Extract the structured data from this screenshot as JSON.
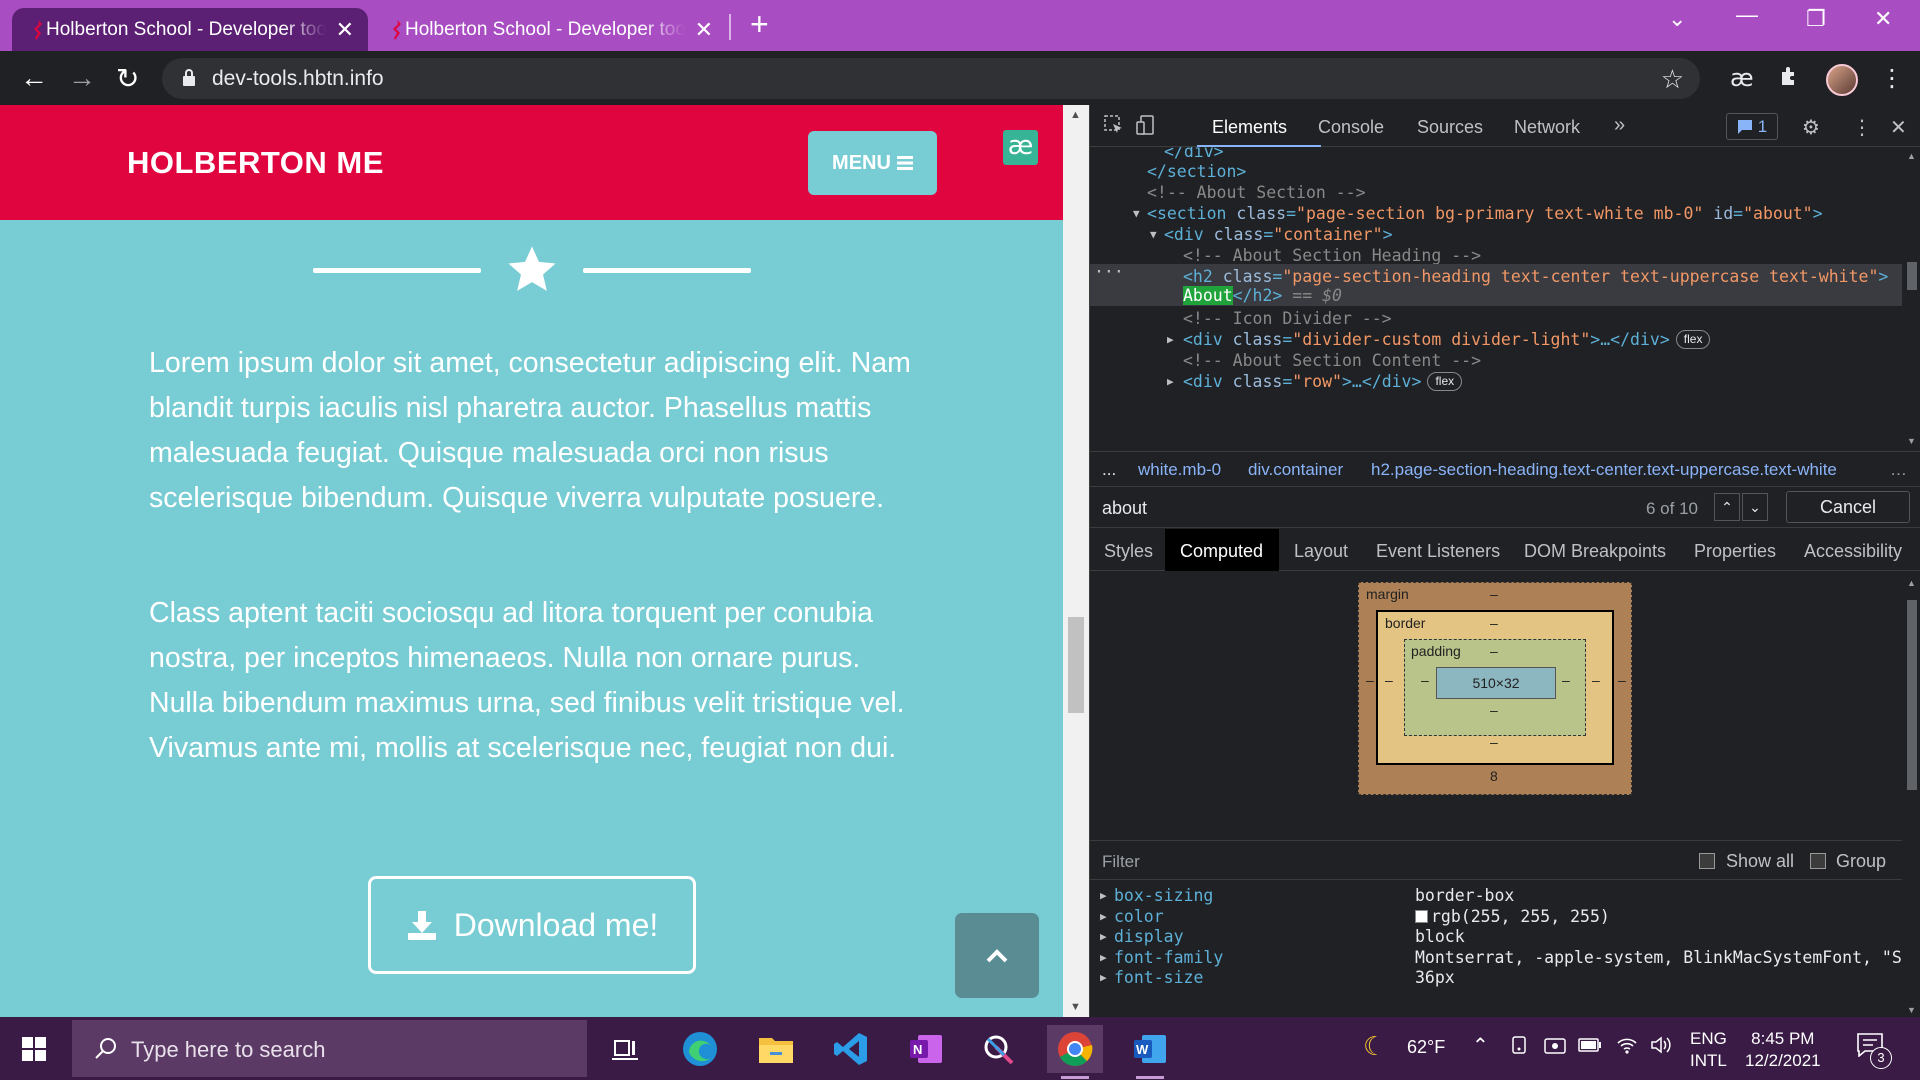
{
  "browser": {
    "tabs": [
      {
        "title": "Holberton School - Developer tools",
        "active": true
      },
      {
        "title": "Holberton School - Developer tools",
        "active": false
      }
    ],
    "url": "dev-tools.hbtn.info"
  },
  "page": {
    "brand": "HOLBERTON ME",
    "menu_label": "MENU",
    "paragraphs": [
      "Lorem ipsum dolor sit amet, consectetur adipiscing elit. Nam blandit turpis iaculis nisl pharetra auctor. Phasellus mattis malesuada feugiat. Quisque malesuada orci non risus scelerisque bibendum. Quisque viverra vulputate posuere.",
      "Class aptent taciti sociosqu ad litora torquent per conubia nostra, per inceptos himenaeos. Nulla non ornare purus. Nulla bibendum maximus urna, sed finibus velit tristique vel. Vivamus ante mi, mollis at scelerisque nec, feugiat non dui."
    ],
    "download_label": "Download me!",
    "colors": {
      "nav": "#e0053f",
      "bg": "#78ccd3"
    }
  },
  "devtools": {
    "tabs": [
      "Elements",
      "Console",
      "Sources",
      "Network"
    ],
    "issues_count": "1",
    "dom": {
      "line0_close": "</div>",
      "line1_close": "</section>",
      "comment_about_section": "<!-- About Section -->",
      "section_tag": "section",
      "section_class": "\"page-section bg-primary text-white mb-0\"",
      "section_id": "\"about\"",
      "div_container_class": "\"container\"",
      "comment_heading": "<!-- About Section Heading -->",
      "h2_class": "\"page-section-heading text-center text-uppercase text-white\"",
      "h2_text": "About",
      "h2_suffix": "== $0",
      "comment_divider": "<!-- Icon Divider -->",
      "div_divider_class": "\"divider-custom divider-light\"",
      "comment_content": "<!-- About Section Content -->",
      "div_row_class": "\"row\"",
      "pill_flex": "flex"
    },
    "breadcrumbs": [
      "...",
      "white.mb-0",
      "div.container",
      "h2.page-section-heading.text-center.text-uppercase.text-white"
    ],
    "search": {
      "query": "about",
      "match": "6 of 10",
      "cancel_label": "Cancel"
    },
    "subtabs": [
      "Styles",
      "Computed",
      "Layout",
      "Event Listeners",
      "DOM Breakpoints",
      "Properties",
      "Accessibility"
    ],
    "box_model": {
      "margin_label": "margin",
      "border_label": "border",
      "padding_label": "padding",
      "content_size": "510×32",
      "margin_top": "–",
      "margin_bottom": "8",
      "dash": "–"
    },
    "filter_placeholder": "Filter",
    "show_all_label": "Show all",
    "group_label": "Group",
    "computed": [
      {
        "name": "box-sizing",
        "value": "border-box"
      },
      {
        "name": "color",
        "value": "rgb(255, 255, 255)"
      },
      {
        "name": "display",
        "value": "block"
      },
      {
        "name": "font-family",
        "value": "Montserrat, -apple-system, BlinkMacSystemFont, \"S"
      },
      {
        "name": "font-size",
        "value": "36px"
      }
    ]
  },
  "taskbar": {
    "search_placeholder": "Type here to search",
    "weather": "62°F",
    "lang_top": "ENG",
    "lang_bottom": "INTL",
    "time": "8:45 PM",
    "date": "12/2/2021",
    "notifications": "3"
  }
}
